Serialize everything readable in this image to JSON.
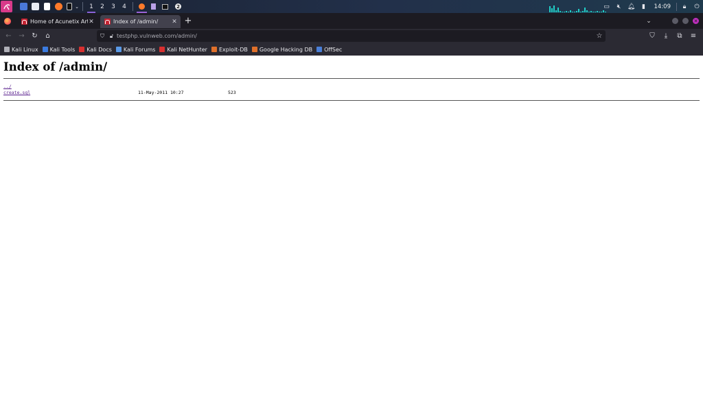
{
  "taskbar": {
    "workspaces": [
      "1",
      "2",
      "3",
      "4"
    ],
    "active_workspace": "1",
    "notification_count": "2",
    "clock": "14:09",
    "colors": {
      "menu": "#d83a8a",
      "cpu_graph": "#21d0c8",
      "active_indicator": "#8a62d8"
    }
  },
  "browser": {
    "tabs": [
      {
        "title": "Home of Acunetix Art",
        "active": false
      },
      {
        "title": "Index of /admin/",
        "active": true
      }
    ],
    "url": "testphp.vulnweb.com/admin/",
    "bookmarks": [
      {
        "label": "Kali Linux",
        "icon": "kali-icon",
        "color": "#b0b0b8"
      },
      {
        "label": "Kali Tools",
        "icon": "kali-tools-icon",
        "color": "#3b7be0"
      },
      {
        "label": "Kali Docs",
        "icon": "kali-docs-icon",
        "color": "#d83030"
      },
      {
        "label": "Kali Forums",
        "icon": "kali-forums-icon",
        "color": "#5a9ae8"
      },
      {
        "label": "Kali NetHunter",
        "icon": "nethunter-icon",
        "color": "#d83030"
      },
      {
        "label": "Exploit-DB",
        "icon": "exploit-db-icon",
        "color": "#e0702a"
      },
      {
        "label": "Google Hacking DB",
        "icon": "ghdb-icon",
        "color": "#e0702a"
      },
      {
        "label": "OffSec",
        "icon": "offsec-icon",
        "color": "#4a7fd8"
      }
    ]
  },
  "page": {
    "heading": "Index of /admin/",
    "entries": [
      {
        "name": "../",
        "date": "",
        "size": ""
      },
      {
        "name": "create.sql",
        "date": "11-May-2011 10:27",
        "size": "523"
      }
    ]
  }
}
